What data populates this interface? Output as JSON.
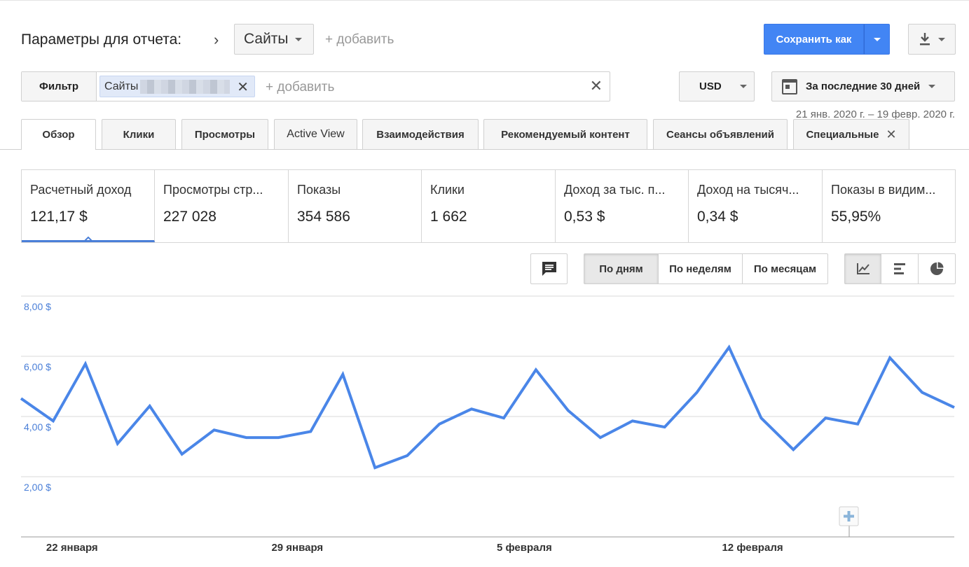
{
  "header": {
    "title": "Параметры для отчета:",
    "dimension": "Сайты",
    "add_dimension": "+ добавить",
    "save_label": "Сохранить как"
  },
  "filter": {
    "label": "Фильтр",
    "chip_label": "Сайты",
    "add": "+ добавить"
  },
  "currency": "USD",
  "date": {
    "label": "За последние 30 дней",
    "range": "21 янв. 2020 г. – 19 февр. 2020 г."
  },
  "tabs": [
    {
      "label": "Обзор"
    },
    {
      "label": "Клики"
    },
    {
      "label": "Просмотры"
    },
    {
      "label": "Active View"
    },
    {
      "label": "Взаимодействия"
    },
    {
      "label": "Рекомендуемый контент"
    },
    {
      "label": "Сеансы объявлений"
    },
    {
      "label": "Специальные"
    }
  ],
  "metrics": [
    {
      "label": "Расчетный доход",
      "value": "121,17 $"
    },
    {
      "label": "Просмотры стр...",
      "value": "227 028"
    },
    {
      "label": "Показы",
      "value": "354 586"
    },
    {
      "label": "Клики",
      "value": "1 662"
    },
    {
      "label": "Доход за тыс. п...",
      "value": "0,53 $"
    },
    {
      "label": "Доход на тысяч...",
      "value": "0,34 $"
    },
    {
      "label": "Показы в видим...",
      "value": "55,95%"
    }
  ],
  "granularity": {
    "day": "По дням",
    "week": "По неделям",
    "month": "По месяцам"
  },
  "icons": {
    "comment": "comment-icon",
    "download": "download-icon",
    "calendar": "calendar-icon",
    "line_chart": "line-chart-icon",
    "bar_chart": "bar-chart-icon",
    "pie_chart": "pie-chart-icon",
    "annotation": "plus-icon"
  },
  "colors": {
    "accent": "#4285f4",
    "series": "#4a86e8"
  },
  "chart_data": {
    "type": "line",
    "y_ticks": [
      "2,00 $",
      "4,00 $",
      "6,00 $",
      "8,00 $"
    ],
    "ylim": [
      0,
      8
    ],
    "x_labels": [
      {
        "label": "22 января",
        "index": 1
      },
      {
        "label": "29 января",
        "index": 8
      },
      {
        "label": "5 февраля",
        "index": 15
      },
      {
        "label": "12 февраля",
        "index": 22
      }
    ],
    "x": [
      "21 янв.",
      "22 янв.",
      "23 янв.",
      "24 янв.",
      "25 янв.",
      "26 янв.",
      "27 янв.",
      "28 янв.",
      "29 янв.",
      "30 янв.",
      "31 янв.",
      "1 февр.",
      "2 февр.",
      "3 февр.",
      "4 февр.",
      "5 февр.",
      "6 февр.",
      "7 февр.",
      "8 февр.",
      "9 февр.",
      "10 февр.",
      "11 февр.",
      "12 февр.",
      "13 февр.",
      "14 февр.",
      "15 февр.",
      "16 февр.",
      "17 февр.",
      "18 февр.",
      "19 февр."
    ],
    "series": [
      {
        "values": [
          4.6,
          3.85,
          5.75,
          3.1,
          4.35,
          2.75,
          3.55,
          3.3,
          3.3,
          3.5,
          5.4,
          2.3,
          2.7,
          3.75,
          4.25,
          3.95,
          5.55,
          4.2,
          3.3,
          3.85,
          3.65,
          4.8,
          6.3,
          3.95,
          2.9,
          3.95,
          3.75,
          5.95,
          4.8,
          4.3
        ]
      }
    ]
  }
}
